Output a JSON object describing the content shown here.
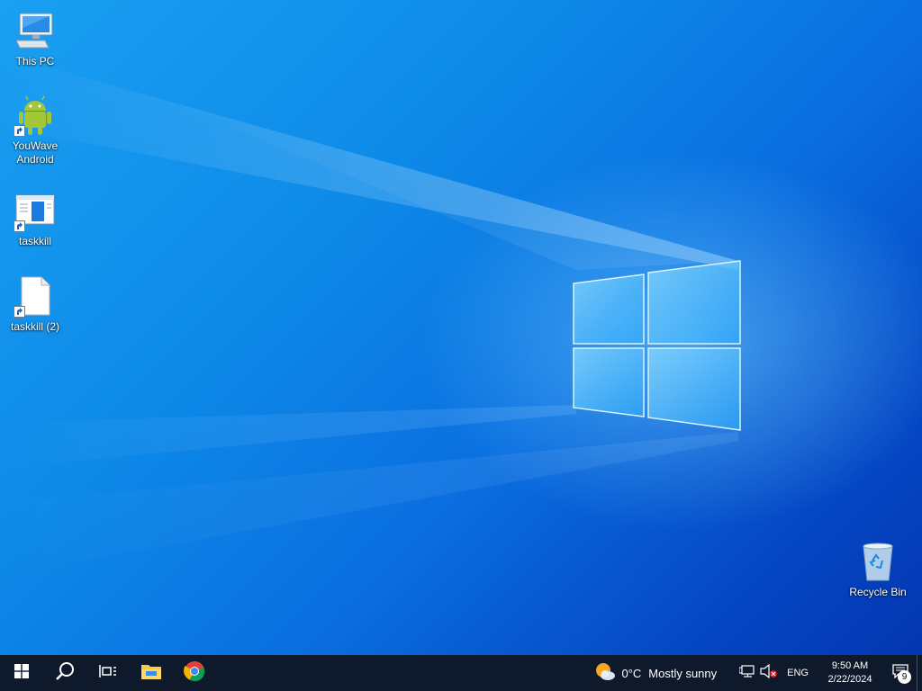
{
  "desktop": {
    "icons": [
      {
        "label": "This PC",
        "icon": "monitor-icon"
      },
      {
        "label": "YouWave Android",
        "icon": "android-icon"
      },
      {
        "label": "taskkill",
        "icon": "app-window-icon"
      },
      {
        "label": "taskkill (2)",
        "icon": "blank-file-icon"
      },
      {
        "label": "Recycle Bin",
        "icon": "recycle-bin-icon"
      }
    ]
  },
  "taskbar": {
    "start": "windows-start-icon",
    "search": "search-icon",
    "task_view": "task-view-icon",
    "pinned": [
      {
        "name": "File Explorer",
        "icon": "folder-icon"
      },
      {
        "name": "Google Chrome",
        "icon": "chrome-icon"
      }
    ],
    "weather": {
      "temperature": "0°C",
      "condition": "Mostly sunny",
      "icon": "sun-cloud-icon"
    },
    "tray": {
      "network_icon": "network-icon",
      "volume_icon": "volume-muted-icon",
      "language": "ENG"
    },
    "clock": {
      "time": "9:50 AM",
      "date": "2/22/2024"
    },
    "notifications": {
      "count": "9",
      "icon": "action-center-icon"
    }
  },
  "colors": {
    "taskbar_bg": "#0e1a2b",
    "wallpaper_light": "#1aa0f2",
    "wallpaper_dark": "#0336b0"
  }
}
